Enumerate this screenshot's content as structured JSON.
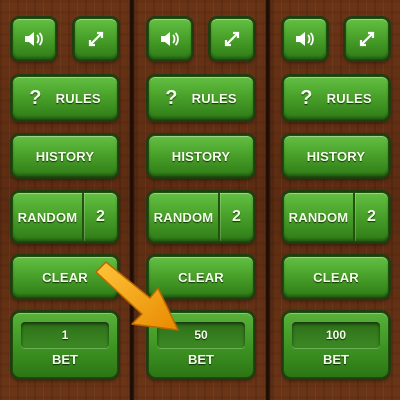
{
  "panels": [
    {
      "rules_mark": "?",
      "rules_label": "RULES",
      "history_label": "HISTORY",
      "random_label": "RANDOM",
      "random_count": "2",
      "clear_label": "CLEAR",
      "bet_value": "1",
      "bet_label": "BET"
    },
    {
      "rules_mark": "?",
      "rules_label": "RULES",
      "history_label": "HISTORY",
      "random_label": "RANDOM",
      "random_count": "2",
      "clear_label": "CLEAR",
      "bet_value": "50",
      "bet_label": "BET"
    },
    {
      "rules_mark": "?",
      "rules_label": "RULES",
      "history_label": "HISTORY",
      "random_label": "RANDOM",
      "random_count": "2",
      "clear_label": "CLEAR",
      "bet_value": "100",
      "bet_label": "BET"
    }
  ],
  "icons": {
    "sound": "speaker-icon",
    "fullscreen": "expand-icon",
    "pointer": "arrow-pointer-icon"
  },
  "colors": {
    "button_green": "#4aa22b",
    "wood": "#5c2c12",
    "arrow_orange": "#f2a20c"
  }
}
